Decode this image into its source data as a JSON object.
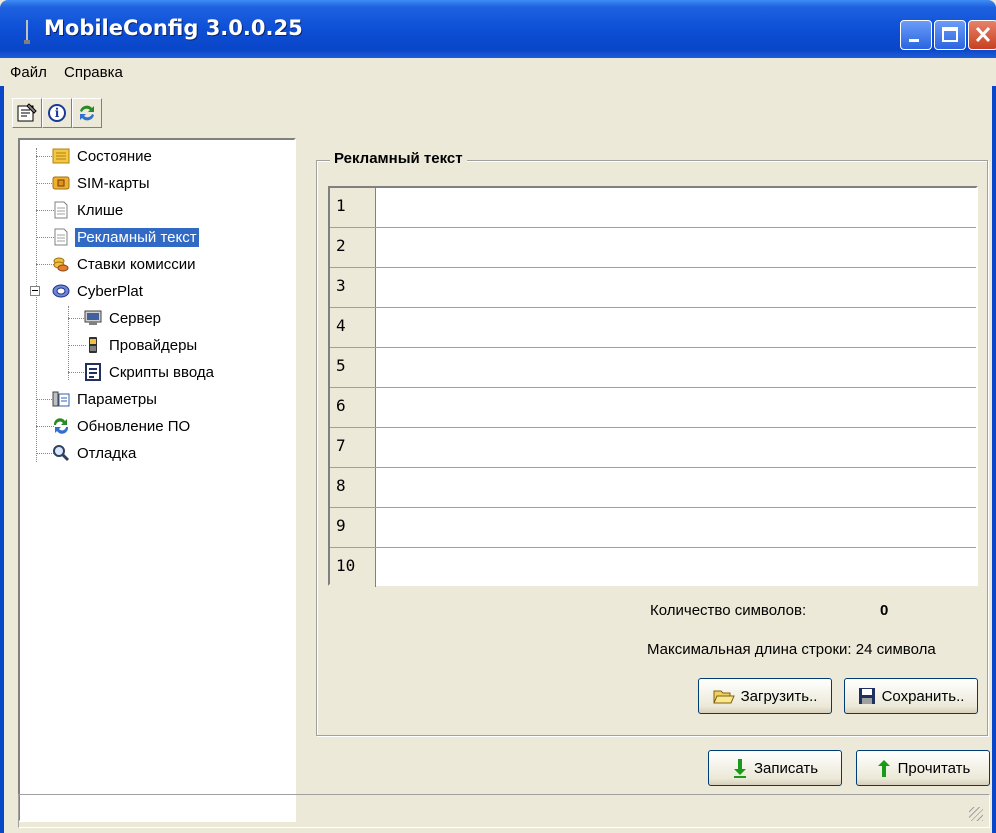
{
  "window": {
    "title": "MobileConfig 3.0.0.25",
    "titlebar_color": "#0a46c8"
  },
  "menu": [
    "Файл",
    "Справка"
  ],
  "toolbar": {
    "buttons": [
      "properties-icon",
      "info-icon",
      "update-icon"
    ]
  },
  "tree": {
    "items": [
      {
        "label": "Состояние",
        "icon": "status-icon"
      },
      {
        "label": "SIM-карты",
        "icon": "sim-card-icon"
      },
      {
        "label": "Клише",
        "icon": "document-icon"
      },
      {
        "label": "Рекламный текст",
        "icon": "document-icon",
        "selected": true
      },
      {
        "label": "Ставки комиссии",
        "icon": "coins-icon"
      },
      {
        "label": "CyberPlat",
        "icon": "globe-icon",
        "expanded": true
      },
      {
        "label": "Сервер",
        "icon": "server-icon"
      },
      {
        "label": "Провайдеры",
        "icon": "phone-icon"
      },
      {
        "label": "Скрипты ввода",
        "icon": "script-icon"
      },
      {
        "label": "Параметры",
        "icon": "parameters-icon"
      },
      {
        "label": "Обновление ПО",
        "icon": "update-icon"
      },
      {
        "label": "Отладка",
        "icon": "magnifier-icon"
      }
    ],
    "selection_color": "#316ac5"
  },
  "panel": {
    "title": "Рекламный текст",
    "rows": [
      {
        "num": "1",
        "text": ""
      },
      {
        "num": "2",
        "text": ""
      },
      {
        "num": "3",
        "text": ""
      },
      {
        "num": "4",
        "text": ""
      },
      {
        "num": "5",
        "text": ""
      },
      {
        "num": "6",
        "text": ""
      },
      {
        "num": "7",
        "text": ""
      },
      {
        "num": "8",
        "text": ""
      },
      {
        "num": "9",
        "text": ""
      },
      {
        "num": "10",
        "text": ""
      }
    ],
    "char_count_label": "Количество символов:",
    "char_count_value": "0",
    "max_length_text": "Максимальная длина строки: 24 символа",
    "load_button": "Загрузить..",
    "save_button": "Сохранить.."
  },
  "footer": {
    "write_button": "Записать",
    "read_button": "Прочитать"
  }
}
